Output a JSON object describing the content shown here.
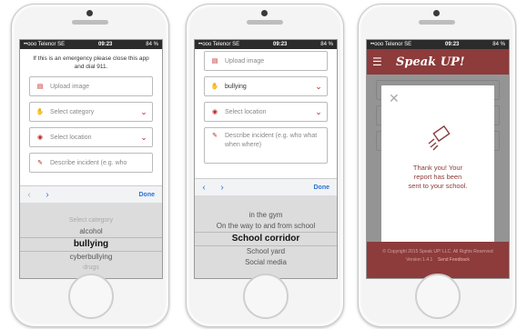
{
  "status": {
    "carrier": "••ooo Telenor SE",
    "time": "09:23",
    "battery": "84 %"
  },
  "phone1": {
    "notice": "If this is an emergency please close this app and dial 911.",
    "upload_label": "Upload image",
    "category_label": "Select category",
    "location_label": "Select location",
    "describe_label": "Describe incident (e.g. who",
    "done_label": "Done",
    "picker_options": [
      "Select category",
      "alcohol",
      "bullying",
      "cyberbullying",
      "drugs"
    ],
    "picker_selected_index": 2
  },
  "phone2": {
    "upload_label": "Upload image",
    "category_value": "bullying",
    "location_label": "Select location",
    "describe_label": "Describe incident (e.g. who what when where)",
    "done_label": "Done",
    "picker_options": [
      "in the gym",
      "On the way to and from school",
      "School corridor",
      "School yard",
      "Social media"
    ],
    "picker_selected_index": 2
  },
  "phone3": {
    "brand": "Speak UP!",
    "modal_message": "Thank you! Your report has been sent to your school.",
    "footer_text": "© Copyright 2015 Speak UP! LLC. All Rights Reserved",
    "footer_version": "Version 1.4.1",
    "footer_feedback": "Send Feedback"
  },
  "colors": {
    "brand": "#8d3b3b",
    "accent": "#b22222",
    "link": "#2a72d6"
  }
}
